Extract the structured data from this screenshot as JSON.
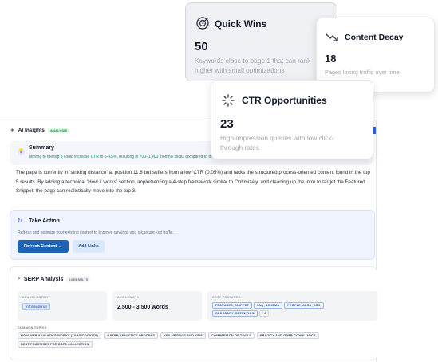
{
  "insights": {
    "title": "AI Insights",
    "badge": "ANALYSIS"
  },
  "summary": {
    "title": "Summary",
    "highlight": "Moving to the top 3 could increase CTR to 5–15%, resulting in 700–1,400 monthly clicks compared to the current traffic potential.",
    "body": "The page is currently in 'striking distance' at position 11.8 but suffers from a low CTR (0.05%) and lacks the structured process-oriented content found in the top 5 results. By adding a technical 'How it works' section, implementing a 4-step framework similar to Optimizely, and cleaning up the intro to target the Featured Snippet, the page can realistically move into the top 3."
  },
  "action": {
    "title": "Take Action",
    "description": "Refresh and optimize your existing content to improve rankings and recapture lost traffic.",
    "primary_label": "Refresh Content →",
    "secondary_label": "Add Links"
  },
  "serp": {
    "title": "SERP Analysis",
    "count": "10 RESULTS",
    "search_intent": {
      "label": "SEARCH INTENT",
      "value": "Informational"
    },
    "avg_length": {
      "label": "AVG LENGTH",
      "value": "2,500 - 3,500 words"
    },
    "serp_features": {
      "label": "SERP FEATURES",
      "items": [
        "FEATURED_SNIPPET",
        "FAQ_SCHEMA",
        "PEOPLE_ALSO_ASK",
        "GLOSSARY_DEFINITION"
      ],
      "more": "+4"
    },
    "common_topics": {
      "label": "COMMON TOPICS",
      "items": [
        "HOW WEB ANALYTICS WORKS (TAGS/COOKIES)",
        "4-STEP ANALYTICS PROCESS",
        "KEY METRICS AND KPIS",
        "COMPARISON OF TOOLS",
        "PRIVACY AND GDPR COMPLIANCE",
        "BEST PRACTICES FOR DATA COLLECTION"
      ]
    }
  },
  "cards": {
    "quick_wins": {
      "title": "Quick Wins",
      "value": "50",
      "description": "Keywords close to page 1 that can rank higher with small optimizations",
      "icon": "target-icon"
    },
    "content_decay": {
      "title": "Content Decay",
      "value": "18",
      "description": "Pages losing traffic over time",
      "icon": "trend-down-icon"
    },
    "ctr_opportunities": {
      "title": "CTR Opportunities",
      "value": "23",
      "description": "High-impression queries with low click-through rates",
      "icon": "sparkle-icon"
    }
  },
  "colors": {
    "primary": "#1e63b4",
    "accent_green": "#0f8a6a",
    "action_bg": "#eff4ff"
  }
}
